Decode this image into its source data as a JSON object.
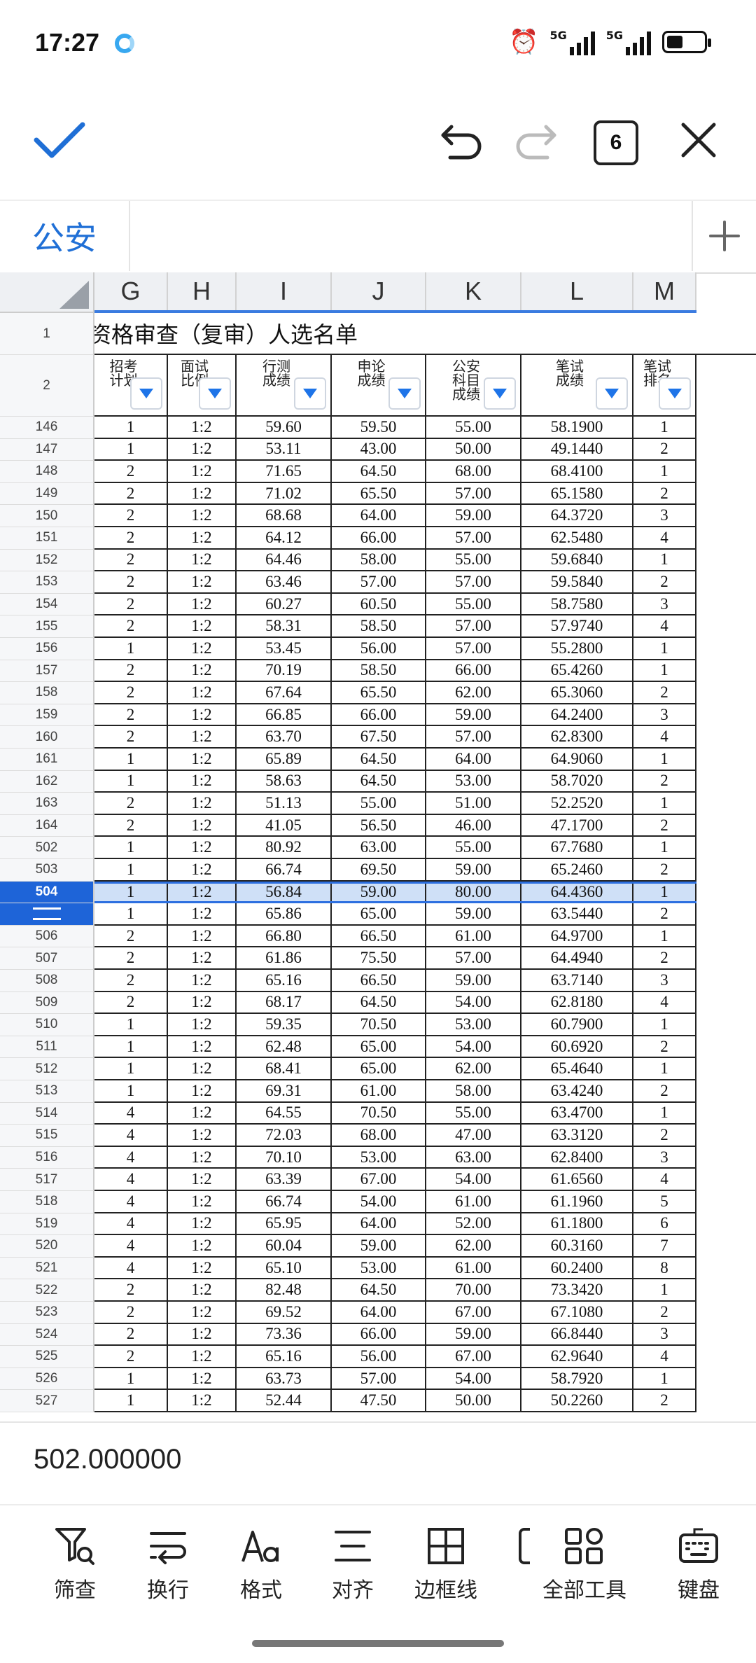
{
  "status_bar": {
    "time": "17:27",
    "net1": "5G",
    "net2": "5G"
  },
  "toolbar": {
    "tab_count": "6"
  },
  "sheet": {
    "tab_label": "公安"
  },
  "columns": [
    "G",
    "H",
    "I",
    "J",
    "K",
    "L",
    "M"
  ],
  "title_row": {
    "num": "1",
    "text": "资格审查（复审）人选名单"
  },
  "header_row": {
    "num": "2",
    "cells": [
      "招考\n计划",
      "面试\n比例",
      "行测\n成绩",
      "申论\n成绩",
      "公安\n科目\n成绩",
      "笔试\n成绩",
      "笔试\n排名"
    ]
  },
  "rows": [
    {
      "num": "146",
      "cells": [
        "1",
        "1:2",
        "59.60",
        "59.50",
        "55.00",
        "58.1900",
        "1"
      ]
    },
    {
      "num": "147",
      "cells": [
        "1",
        "1:2",
        "53.11",
        "43.00",
        "50.00",
        "49.1440",
        "2"
      ]
    },
    {
      "num": "148",
      "cells": [
        "2",
        "1:2",
        "71.65",
        "64.50",
        "68.00",
        "68.4100",
        "1"
      ]
    },
    {
      "num": "149",
      "cells": [
        "2",
        "1:2",
        "71.02",
        "65.50",
        "57.00",
        "65.1580",
        "2"
      ]
    },
    {
      "num": "150",
      "cells": [
        "2",
        "1:2",
        "68.68",
        "64.00",
        "59.00",
        "64.3720",
        "3"
      ]
    },
    {
      "num": "151",
      "cells": [
        "2",
        "1:2",
        "64.12",
        "66.00",
        "57.00",
        "62.5480",
        "4"
      ]
    },
    {
      "num": "152",
      "cells": [
        "2",
        "1:2",
        "64.46",
        "58.00",
        "55.00",
        "59.6840",
        "1"
      ]
    },
    {
      "num": "153",
      "cells": [
        "2",
        "1:2",
        "63.46",
        "57.00",
        "57.00",
        "59.5840",
        "2"
      ]
    },
    {
      "num": "154",
      "cells": [
        "2",
        "1:2",
        "60.27",
        "60.50",
        "55.00",
        "58.7580",
        "3"
      ]
    },
    {
      "num": "155",
      "cells": [
        "2",
        "1:2",
        "58.31",
        "58.50",
        "57.00",
        "57.9740",
        "4"
      ]
    },
    {
      "num": "156",
      "cells": [
        "1",
        "1:2",
        "53.45",
        "56.00",
        "57.00",
        "55.2800",
        "1"
      ]
    },
    {
      "num": "157",
      "cells": [
        "2",
        "1:2",
        "70.19",
        "58.50",
        "66.00",
        "65.4260",
        "1"
      ]
    },
    {
      "num": "158",
      "cells": [
        "2",
        "1:2",
        "67.64",
        "65.50",
        "62.00",
        "65.3060",
        "2"
      ]
    },
    {
      "num": "159",
      "cells": [
        "2",
        "1:2",
        "66.85",
        "66.00",
        "59.00",
        "64.2400",
        "3"
      ]
    },
    {
      "num": "160",
      "cells": [
        "2",
        "1:2",
        "63.70",
        "67.50",
        "57.00",
        "62.8300",
        "4"
      ]
    },
    {
      "num": "161",
      "cells": [
        "1",
        "1:2",
        "65.89",
        "64.50",
        "64.00",
        "64.9060",
        "1"
      ]
    },
    {
      "num": "162",
      "cells": [
        "1",
        "1:2",
        "58.63",
        "64.50",
        "53.00",
        "58.7020",
        "2"
      ]
    },
    {
      "num": "163",
      "cells": [
        "2",
        "1:2",
        "51.13",
        "55.00",
        "51.00",
        "52.2520",
        "1"
      ]
    },
    {
      "num": "164",
      "cells": [
        "2",
        "1:2",
        "41.05",
        "56.50",
        "46.00",
        "47.1700",
        "2"
      ]
    },
    {
      "num": "502",
      "cells": [
        "1",
        "1:2",
        "80.92",
        "63.00",
        "55.00",
        "67.7680",
        "1"
      ]
    },
    {
      "num": "503",
      "cells": [
        "1",
        "1:2",
        "66.74",
        "69.50",
        "59.00",
        "65.2460",
        "2"
      ]
    },
    {
      "num": "504",
      "cells": [
        "1",
        "1:2",
        "56.84",
        "59.00",
        "80.00",
        "64.4360",
        "1"
      ],
      "selected": true
    },
    {
      "num": "",
      "cells": [
        "1",
        "1:2",
        "65.86",
        "65.00",
        "59.00",
        "63.5440",
        "2"
      ],
      "handle": true
    },
    {
      "num": "506",
      "cells": [
        "2",
        "1:2",
        "66.80",
        "66.50",
        "61.00",
        "64.9700",
        "1"
      ]
    },
    {
      "num": "507",
      "cells": [
        "2",
        "1:2",
        "61.86",
        "75.50",
        "57.00",
        "64.4940",
        "2"
      ]
    },
    {
      "num": "508",
      "cells": [
        "2",
        "1:2",
        "65.16",
        "66.50",
        "59.00",
        "63.7140",
        "3"
      ]
    },
    {
      "num": "509",
      "cells": [
        "2",
        "1:2",
        "68.17",
        "64.50",
        "54.00",
        "62.8180",
        "4"
      ]
    },
    {
      "num": "510",
      "cells": [
        "1",
        "1:2",
        "59.35",
        "70.50",
        "53.00",
        "60.7900",
        "1"
      ]
    },
    {
      "num": "511",
      "cells": [
        "1",
        "1:2",
        "62.48",
        "65.00",
        "54.00",
        "60.6920",
        "2"
      ]
    },
    {
      "num": "512",
      "cells": [
        "1",
        "1:2",
        "68.41",
        "65.00",
        "62.00",
        "65.4640",
        "1"
      ]
    },
    {
      "num": "513",
      "cells": [
        "1",
        "1:2",
        "69.31",
        "61.00",
        "58.00",
        "63.4240",
        "2"
      ]
    },
    {
      "num": "514",
      "cells": [
        "4",
        "1:2",
        "64.55",
        "70.50",
        "55.00",
        "63.4700",
        "1"
      ]
    },
    {
      "num": "515",
      "cells": [
        "4",
        "1:2",
        "72.03",
        "68.00",
        "47.00",
        "63.3120",
        "2"
      ]
    },
    {
      "num": "516",
      "cells": [
        "4",
        "1:2",
        "70.10",
        "53.00",
        "63.00",
        "62.8400",
        "3"
      ]
    },
    {
      "num": "517",
      "cells": [
        "4",
        "1:2",
        "63.39",
        "67.00",
        "54.00",
        "61.6560",
        "4"
      ]
    },
    {
      "num": "518",
      "cells": [
        "4",
        "1:2",
        "66.74",
        "54.00",
        "61.00",
        "61.1960",
        "5"
      ]
    },
    {
      "num": "519",
      "cells": [
        "4",
        "1:2",
        "65.95",
        "64.00",
        "52.00",
        "61.1800",
        "6"
      ]
    },
    {
      "num": "520",
      "cells": [
        "4",
        "1:2",
        "60.04",
        "59.00",
        "62.00",
        "60.3160",
        "7"
      ]
    },
    {
      "num": "521",
      "cells": [
        "4",
        "1:2",
        "65.10",
        "53.00",
        "61.00",
        "60.2400",
        "8"
      ]
    },
    {
      "num": "522",
      "cells": [
        "2",
        "1:2",
        "82.48",
        "64.50",
        "70.00",
        "73.3420",
        "1"
      ]
    },
    {
      "num": "523",
      "cells": [
        "2",
        "1:2",
        "69.52",
        "64.00",
        "67.00",
        "67.1080",
        "2"
      ]
    },
    {
      "num": "524",
      "cells": [
        "2",
        "1:2",
        "73.36",
        "66.00",
        "59.00",
        "66.8440",
        "3"
      ]
    },
    {
      "num": "525",
      "cells": [
        "2",
        "1:2",
        "65.16",
        "56.00",
        "67.00",
        "62.9640",
        "4"
      ]
    },
    {
      "num": "526",
      "cells": [
        "1",
        "1:2",
        "63.73",
        "57.00",
        "54.00",
        "58.7920",
        "1"
      ]
    },
    {
      "num": "527",
      "cells": [
        "1",
        "1:2",
        "52.44",
        "47.50",
        "50.00",
        "50.2260",
        "2"
      ]
    }
  ],
  "formula_bar": {
    "value": "502.000000"
  },
  "bottom_tools": [
    {
      "label": "筛查",
      "icon": "filter-search-icon"
    },
    {
      "label": "换行",
      "icon": "wrap-text-icon"
    },
    {
      "label": "格式",
      "icon": "text-format-icon"
    },
    {
      "label": "对齐",
      "icon": "align-icon"
    },
    {
      "label": "边框线",
      "icon": "border-icon"
    },
    {
      "label": "全部工具",
      "icon": "all-tools-icon"
    },
    {
      "label": "键盘",
      "icon": "keyboard-icon"
    }
  ]
}
